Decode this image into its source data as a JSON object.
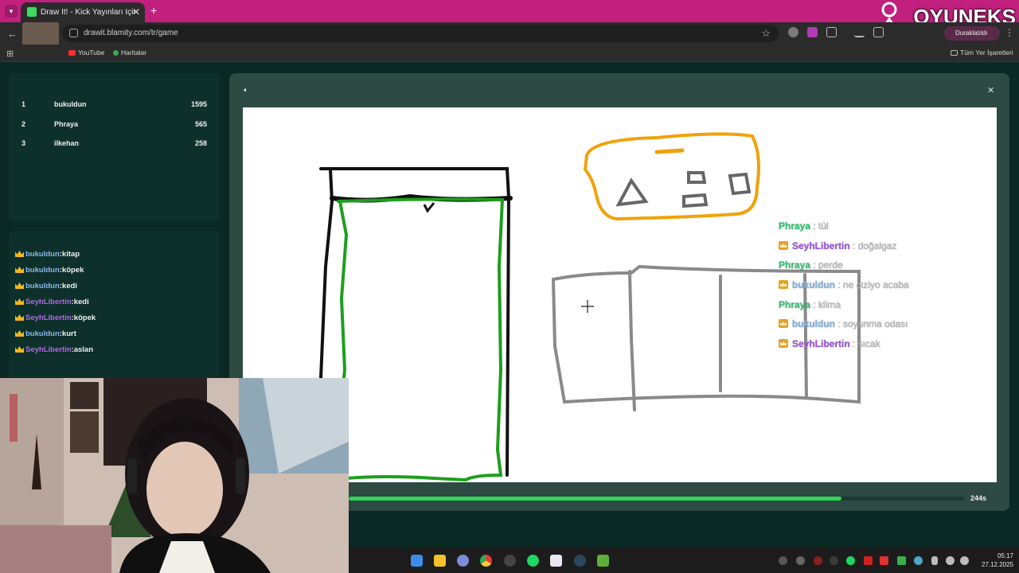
{
  "browser": {
    "tab_title": "Draw It! - Kick Yayınları İçin Çiz...",
    "url": "drawit.blamity.com/tr/game",
    "paused_label": "Duraklatıldı",
    "bookmarks": [
      {
        "label": "YouTube",
        "color": "#ff2d2d"
      },
      {
        "label": "Haritalar",
        "color": "#3aa657"
      }
    ],
    "all_bookmarks_label": "Tüm Yer İşaretleri"
  },
  "overlay_logo": "OYUNEKS",
  "leaderboard": [
    {
      "rank": "1",
      "name": "bukuldun",
      "score": "1595"
    },
    {
      "rank": "2",
      "name": "Phraya",
      "score": "565"
    },
    {
      "rank": "3",
      "name": "ilkehan",
      "score": "258"
    }
  ],
  "guesses": [
    {
      "user": "bukuldun",
      "word": "kitap",
      "color": "#8ab7e8"
    },
    {
      "user": "bukuldun",
      "word": "köpek",
      "color": "#8ab7e8"
    },
    {
      "user": "bukuldun",
      "word": "kedi",
      "color": "#8ab7e8"
    },
    {
      "user": "SeyhLibertin",
      "word": "kedi",
      "color": "#b06ae0"
    },
    {
      "user": "SeyhLibertin",
      "word": "köpek",
      "color": "#b06ae0"
    },
    {
      "user": "bukuldun",
      "word": "kurt",
      "color": "#8ab7e8"
    },
    {
      "user": "SeyhLibertin",
      "word": "aslan",
      "color": "#b06ae0"
    }
  ],
  "chat": [
    {
      "user": "Phraya",
      "msg": "tül",
      "color": "#2ecc71",
      "badge": false
    },
    {
      "user": "SeyhLibertin",
      "msg": "doğalgaz",
      "color": "#a259e0",
      "badge": true
    },
    {
      "user": "Phraya",
      "msg": "perde",
      "color": "#2ecc71",
      "badge": false
    },
    {
      "user": "bukuldun",
      "msg": "ne çiziyo acaba",
      "color": "#8ab7e8",
      "badge": true
    },
    {
      "user": "Phraya",
      "msg": "klima",
      "color": "#2ecc71",
      "badge": false
    },
    {
      "user": "bukuldun",
      "msg": "soyunma odası",
      "color": "#8ab7e8",
      "badge": true
    },
    {
      "user": "SeyhLibertin",
      "msg": "sıcak",
      "color": "#a259e0",
      "badge": true
    }
  ],
  "timer": {
    "label": "244s",
    "progress_fraction": 0.8
  },
  "taskbar": {
    "time": "05:17",
    "date": "27.12.2025",
    "apps": [
      "windows-start",
      "file-explorer",
      "settings",
      "chrome",
      "obs",
      "spotify",
      "app",
      "steam",
      "minecraft"
    ]
  },
  "colors": {
    "accent_green": "#2fd553",
    "tab_bar": "#c2207f",
    "panel_bg": "#0d302b"
  }
}
